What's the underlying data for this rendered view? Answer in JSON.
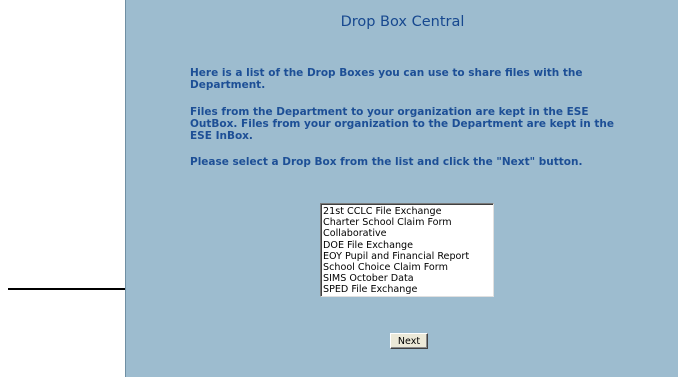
{
  "page": {
    "title": "Drop Box Central",
    "intro_text": "Here is a list of the Drop Boxes you can use to share files with the Department.",
    "outbox_inbox_text": "Files from the Department to your organization are kept in the ESE OutBox. Files from your organization to the Department are kept in the ESE InBox.",
    "instruction_text": "Please select a Drop Box from the list and click the \"Next\" button."
  },
  "dropbox_list": {
    "items": [
      "21st CCLC File Exchange",
      "Charter School Claim Form",
      "Collaborative",
      "DOE File Exchange",
      "EOY Pupil and Financial Report",
      "School Choice Claim Form",
      "SIMS October Data",
      "SPED File Exchange"
    ]
  },
  "buttons": {
    "next_label": "Next"
  },
  "colors": {
    "panel_background": "#9dbccf",
    "heading_text": "#17488f",
    "body_text": "#1d4f96"
  },
  "annotation": {
    "icon": "arrow-right-icon"
  }
}
